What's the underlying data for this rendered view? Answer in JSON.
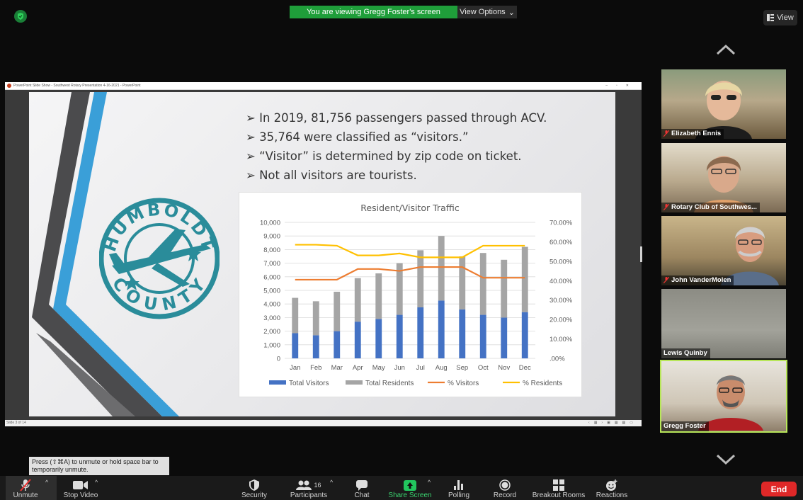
{
  "banner": {
    "viewing_text": "You are viewing Gregg Foster's screen",
    "view_options": "View Options"
  },
  "view_button": "View",
  "ppt_window": {
    "title": "PowerPoint Slide Show  -  Southwest Rotary Presentation 4-16-2021 - PowerPoint",
    "status_left": "Slide 3 of 14"
  },
  "slide": {
    "bullets": [
      "In 2019, 81,756 passengers passed through ACV.",
      "35,764 were classified as “visitors.”",
      "“Visitor” is determined by zip code on ticket.",
      "Not all visitors are tourists."
    ],
    "logo": {
      "top": "HUMBOLDT",
      "bottom": "COUNTY"
    }
  },
  "chart_data": {
    "type": "bar",
    "title": "Resident/Visitor Traffic",
    "categories": [
      "Jan",
      "Feb",
      "Mar",
      "Apr",
      "May",
      "Jun",
      "Jul",
      "Aug",
      "Sep",
      "Oct",
      "Nov",
      "Dec"
    ],
    "stacked": true,
    "y_left": {
      "ticks": [
        "0",
        "1,000",
        "2,000",
        "3,000",
        "4,000",
        "5,000",
        "6,000",
        "7,000",
        "8,000",
        "9,000",
        "10,000"
      ],
      "lim": [
        0,
        10000
      ]
    },
    "y_right": {
      "ticks": [
        ".00%",
        "10.00%",
        "20.00%",
        "30.00%",
        "40.00%",
        "50.00%",
        "60.00%",
        "70.00%"
      ],
      "lim": [
        0,
        70
      ]
    },
    "series": [
      {
        "name": "Total Visitors",
        "type": "bar",
        "axis": "left",
        "color": "#4472c4",
        "values": [
          1850,
          1700,
          2000,
          2700,
          2900,
          3200,
          3750,
          4250,
          3600,
          3200,
          3000,
          3400
        ]
      },
      {
        "name": "Total Residents",
        "type": "bar",
        "axis": "left",
        "color": "#a5a5a5",
        "values": [
          2600,
          2500,
          2900,
          3200,
          3350,
          3800,
          4200,
          4750,
          3900,
          4550,
          4250,
          4800
        ]
      },
      {
        "name": "% Visitors",
        "type": "line",
        "axis": "right",
        "color": "#ed7d31",
        "values": [
          40.5,
          40.5,
          40.5,
          46.0,
          46.0,
          45.0,
          47.0,
          47.0,
          47.0,
          41.5,
          41.5,
          41.5
        ]
      },
      {
        "name": "% Residents",
        "type": "line",
        "axis": "right",
        "color": "#ffc000",
        "values": [
          58.5,
          58.5,
          58.0,
          53.0,
          53.0,
          54.0,
          52.0,
          52.0,
          52.0,
          58.0,
          58.0,
          58.0
        ]
      }
    ],
    "legend_position": "bottom",
    "grid": true
  },
  "participants": [
    {
      "name": "Elizabeth Ennis",
      "muted": true
    },
    {
      "name": "Rotary Club of Southwes...",
      "muted": true
    },
    {
      "name": "John VanderMolen",
      "muted": true
    },
    {
      "name": "Lewis Quinby",
      "muted": false
    },
    {
      "name": "Gregg Foster",
      "muted": false,
      "active_speaker": true
    }
  ],
  "toast": "Press  (⇧⌘A) to unmute or hold space bar to temporarily unmute.",
  "toolbar": {
    "unmute": "Unmute",
    "stop_video": "Stop Video",
    "security": "Security",
    "participants": "Participants",
    "participants_count": "16",
    "chat": "Chat",
    "share_screen": "Share Screen",
    "polling": "Polling",
    "record": "Record",
    "breakout_rooms": "Breakout Rooms",
    "reactions": "Reactions",
    "end": "End"
  },
  "colors": {
    "banner_green": "#1f9e3a",
    "share_green": "#22c55e",
    "end_red": "#e02828",
    "active_border": "#b8e65a"
  }
}
